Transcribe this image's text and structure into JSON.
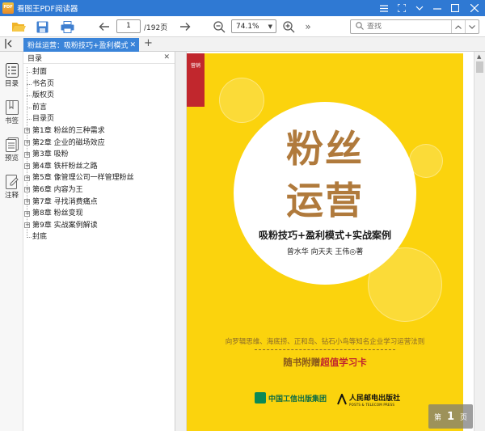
{
  "app": {
    "title": "看图王PDF阅读器"
  },
  "toolbar": {
    "current_page": "1",
    "total_pages": "/192页",
    "zoom": "74.1%",
    "more": "»",
    "search_placeholder": "查找"
  },
  "tabs": [
    {
      "label": "粉丝运营：吸粉技巧+盈利模式"
    }
  ],
  "rail": {
    "toc_label": "目录",
    "bookmark_label": "书签",
    "preview_label": "预览",
    "note_label": "注释"
  },
  "outline": {
    "title": "目录",
    "items": [
      {
        "label": "封面",
        "expandable": false
      },
      {
        "label": "书名页",
        "expandable": false
      },
      {
        "label": "版权页",
        "expandable": false
      },
      {
        "label": "前言",
        "expandable": false
      },
      {
        "label": "目录页",
        "expandable": false
      },
      {
        "label": "第1章 粉丝的三种需求",
        "expandable": true
      },
      {
        "label": "第2章 企业的磁场效应",
        "expandable": true
      },
      {
        "label": "第3章 吸粉",
        "expandable": true
      },
      {
        "label": "第4章 铁杆粉丝之路",
        "expandable": true
      },
      {
        "label": "第5章 像管理公司一样管理粉丝",
        "expandable": true
      },
      {
        "label": "第6章 内容为王",
        "expandable": true
      },
      {
        "label": "第7章 寻找消费痛点",
        "expandable": true
      },
      {
        "label": "第8章 粉丝变现",
        "expandable": true
      },
      {
        "label": "第9章 实战案例解读",
        "expandable": true
      },
      {
        "label": "封底",
        "expandable": false
      }
    ]
  },
  "cover": {
    "series_band": "营销",
    "title_line1": "粉丝",
    "title_line2": "运营",
    "subtitle": "吸粉技巧+盈利模式+实战案例",
    "authors": "曾水华  向天夫  王伟◎著",
    "tagline": "向罗辑思维、海底捞、正和岛、钻石小鸟等知名企业学习运营法则",
    "promo_prefix": "随书附赠",
    "promo_highlight": "超值学习卡",
    "publisher1": "中国工信出版集团",
    "publisher2": "人民邮电出版社",
    "publisher2_en": "POSTS & TELECOM PRESS",
    "colors": {
      "background": "#fbd30d",
      "title": "#b07a3c",
      "band": "#c1272d"
    }
  },
  "pager": {
    "prefix": "第",
    "page": "1",
    "suffix": "页"
  }
}
